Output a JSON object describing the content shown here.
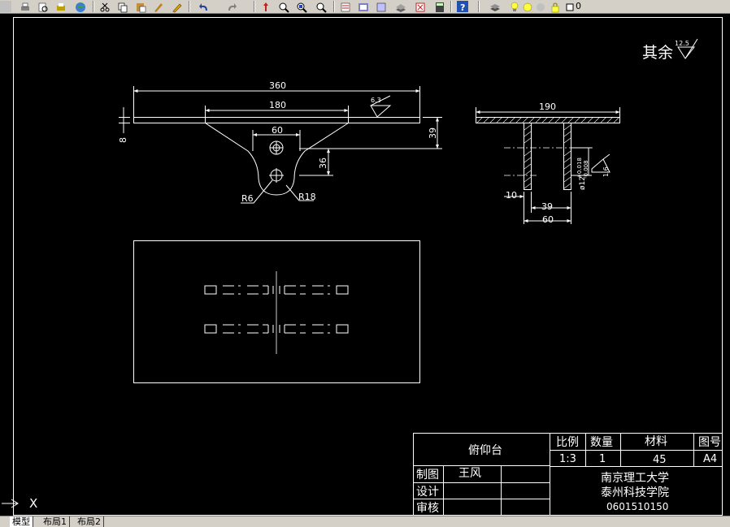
{
  "toolbar": {
    "layer_value": "0",
    "buttons": [
      "print-icon",
      "preview-icon",
      "publish-icon",
      "plot-icon",
      "cut-icon",
      "copy-icon",
      "paste-icon",
      "match-icon",
      "brush-icon",
      "undo-icon",
      "redo-icon",
      "pan-icon",
      "zoom-realtime-icon",
      "zoom-window-icon",
      "zoom-previous-icon",
      "properties-icon",
      "design-center-icon",
      "tool-palette-icon",
      "sheet-set-icon",
      "markup-icon",
      "calculator-icon",
      "help-icon",
      "layer-manager-icon",
      "bulb-icon",
      "sun-icon",
      "freeze-icon",
      "lock-icon",
      "color-square-icon"
    ]
  },
  "roughness_note": {
    "prefix": "其余",
    "value": "12.5"
  },
  "dims": {
    "d360": "360",
    "d180": "180",
    "d60": "60",
    "d8": "8",
    "d39": "39",
    "d36": "36",
    "r6": "R6",
    "r18": "R18",
    "ra63": "6.3",
    "s190": "190",
    "s10": "10",
    "s39": "39",
    "s60": "60",
    "tol": "ø12+0.018\n-0.006",
    "tol_main": "ø12",
    "tol_up": "+0.018",
    "tol_lo": "-0.008",
    "ra16": "1.6"
  },
  "title_block": {
    "part_name": "俯仰台",
    "h_scale": "比例",
    "h_qty": "数量",
    "h_material": "材料",
    "h_drawing_no": "图号",
    "v_scale": "1:3",
    "v_qty": "1",
    "v_material": "45",
    "v_drawing_no": "A4",
    "l_drawn": "制图",
    "v_drawn": "王风",
    "l_design": "设计",
    "l_review": "审核",
    "school1": "南京理工大学",
    "school2": "泰州科技学院",
    "student_id": "0601510150"
  },
  "ucs": {
    "label": "X"
  },
  "tabs": [
    "模型",
    "布局1",
    "布局2"
  ]
}
